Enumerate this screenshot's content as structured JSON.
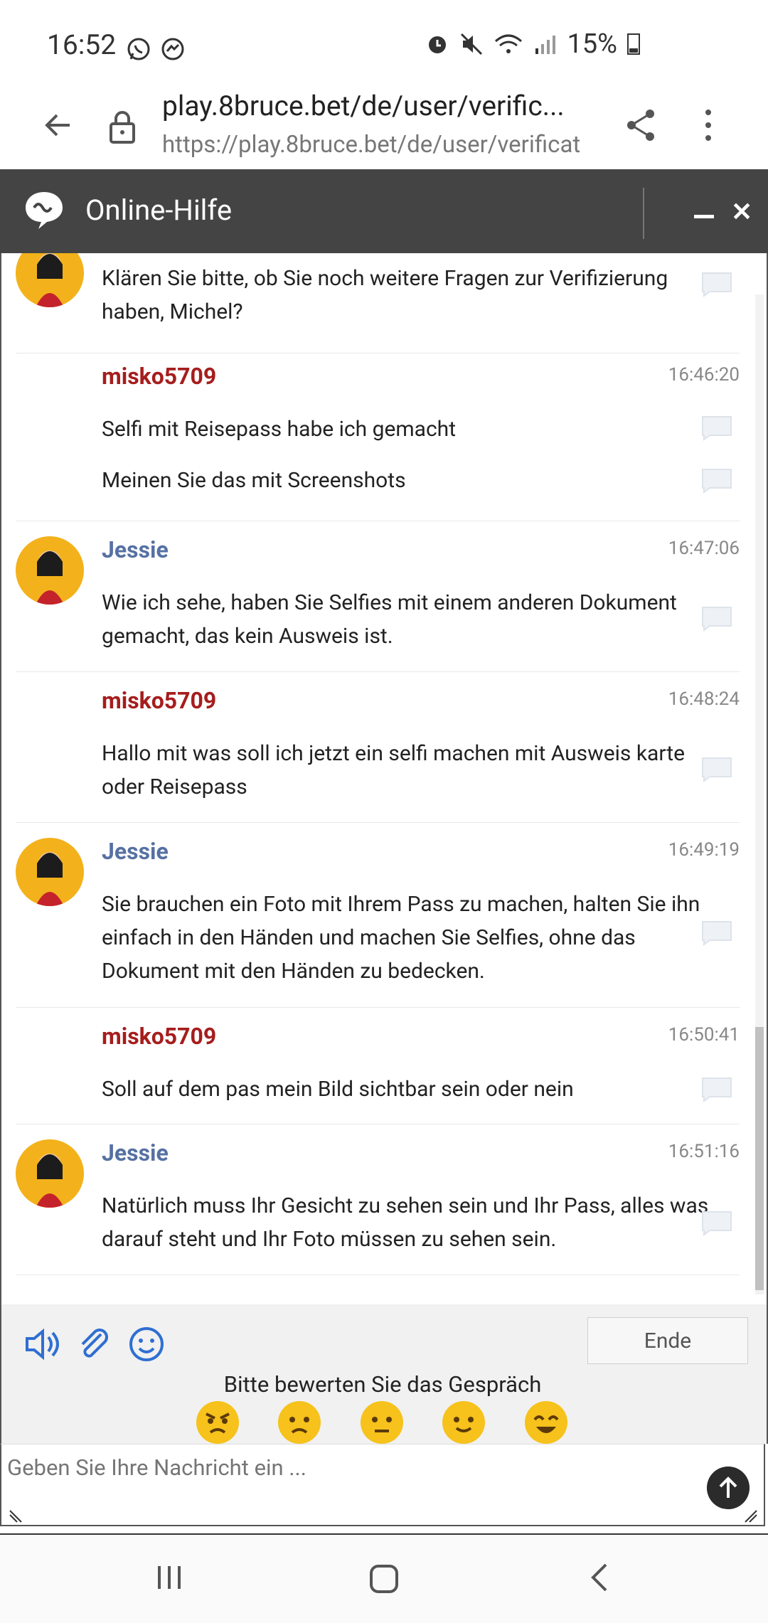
{
  "status_bar": {
    "time": "16:52",
    "battery": "15%",
    "icons": [
      "whatsapp-icon",
      "messenger-icon",
      "alarm-icon",
      "mute-icon",
      "wifi-icon",
      "signal-icon",
      "battery-icon"
    ]
  },
  "browser": {
    "url_title": "play.8bruce.bet/de/user/verific...",
    "url_full": "https://play.8bruce.bet/de/user/verificat"
  },
  "chat_header": {
    "title": "Online-Hilfe"
  },
  "messages": [
    {
      "sender": "",
      "role": "agent",
      "time": "",
      "lines": [
        "Klären Sie bitte, ob Sie noch weitere Fragen zur Verifizierung haben, Michel?"
      ]
    },
    {
      "sender": "misko5709",
      "role": "user",
      "time": "16:46:20",
      "lines": [
        "Selfi mit Reisepass habe ich gemacht",
        "Meinen Sie das mit Screenshots"
      ]
    },
    {
      "sender": "Jessie",
      "role": "agent",
      "time": "16:47:06",
      "lines": [
        "Wie ich sehe, haben Sie Selfies mit einem anderen Dokument gemacht, das kein Ausweis ist."
      ]
    },
    {
      "sender": "misko5709",
      "role": "user",
      "time": "16:48:24",
      "lines": [
        "Hallo mit was soll ich jetzt ein selfi machen mit Ausweis karte oder Reisepass"
      ]
    },
    {
      "sender": "Jessie",
      "role": "agent",
      "time": "16:49:19",
      "lines": [
        "Sie brauchen ein Foto mit Ihrem Pass zu machen, halten Sie ihn einfach in den Händen und machen Sie Selfies, ohne das Dokument mit den Händen zu bedecken."
      ]
    },
    {
      "sender": "misko5709",
      "role": "user",
      "time": "16:50:41",
      "lines": [
        "Soll auf dem pas mein Bild sichtbar sein oder nein"
      ]
    },
    {
      "sender": "Jessie",
      "role": "agent",
      "time": "16:51:16",
      "lines": [
        "Natürlich muss Ihr Gesicht zu sehen sein und Ihr Pass, alles was darauf steht und Ihr Foto müssen zu sehen sein."
      ]
    }
  ],
  "composer": {
    "end_label": "Ende",
    "rating_prompt": "Bitte bewerten Sie das Gespräch",
    "rating_faces": [
      "angry",
      "sad",
      "neutral",
      "smile",
      "love"
    ],
    "input_placeholder": "Geben Sie Ihre Nachricht ein ..."
  },
  "colors": {
    "header_bg": "#444444",
    "user_name": "#a61d1d",
    "agent_name": "#5671a3",
    "accent_blue": "#2f6fd1",
    "emoji_yellow": "#f6c21b"
  }
}
